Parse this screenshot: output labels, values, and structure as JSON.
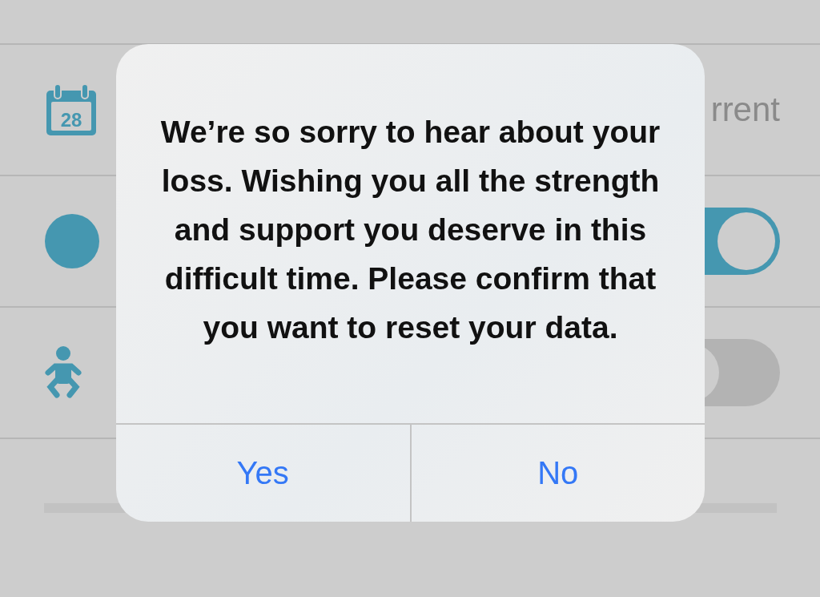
{
  "settings_rows": [
    {
      "kind": "text",
      "calendar_day": "28",
      "value": "rrent"
    },
    {
      "kind": "toggle",
      "on": true
    },
    {
      "kind": "toggle",
      "on": false
    }
  ],
  "alert": {
    "message": "We’re so sorry to hear about your loss. Wishing you all the strength and support you deserve in this difficult time. Please confirm that you want to reset your data.",
    "buttons": [
      {
        "label": "Yes"
      },
      {
        "label": "No"
      }
    ]
  }
}
